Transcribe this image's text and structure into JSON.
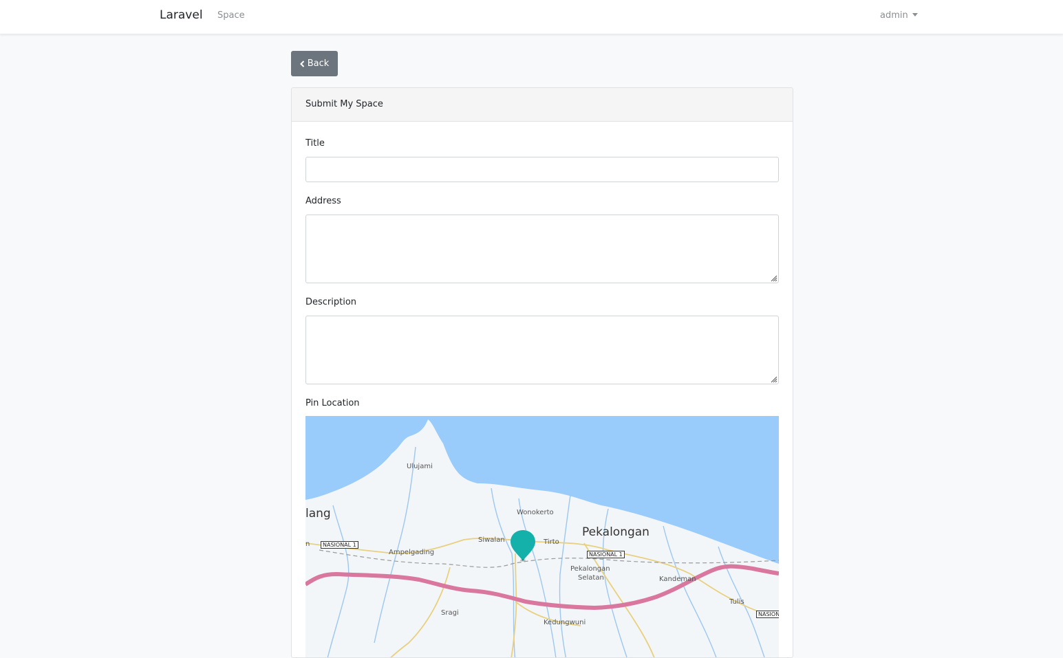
{
  "navbar": {
    "brand": "Laravel",
    "links": [
      "Space"
    ],
    "user": "admin"
  },
  "back_button": {
    "label": "Back"
  },
  "form": {
    "header": "Submit My Space",
    "title_label": "Title",
    "title_value": "",
    "address_label": "Address",
    "address_value": "",
    "description_label": "Description",
    "description_value": "",
    "pin_label": "Pin Location"
  },
  "map": {
    "place_labels": {
      "ulujami": "Ulujami",
      "wonokerto": "Wonokerto",
      "pemalang": "lang",
      "siwalan": "Siwalan",
      "tirto": "Tirto",
      "pekalongan": "Pekalongan",
      "ampelgading": "Ampelgading",
      "pekalongan_selatan_1": "Pekalongan",
      "pekalongan_selatan_2": "Selatan",
      "kandeman": "Kandeman",
      "tulis": "Tulis",
      "sragi": "Sragi",
      "kedungwuni": "Kedungwuni"
    },
    "road_shields": [
      "NASIONAL 1",
      "NASIONAL 1",
      "NASIONAL 1",
      "NASIONAL"
    ],
    "road_edge_label": "n",
    "colors": {
      "sea": "#99ccfb",
      "land": "#f3f6f8",
      "highway": "#d9779e",
      "road": "#e8d07f",
      "river": "#9bc7f0",
      "pin": "#14b1ab"
    }
  }
}
